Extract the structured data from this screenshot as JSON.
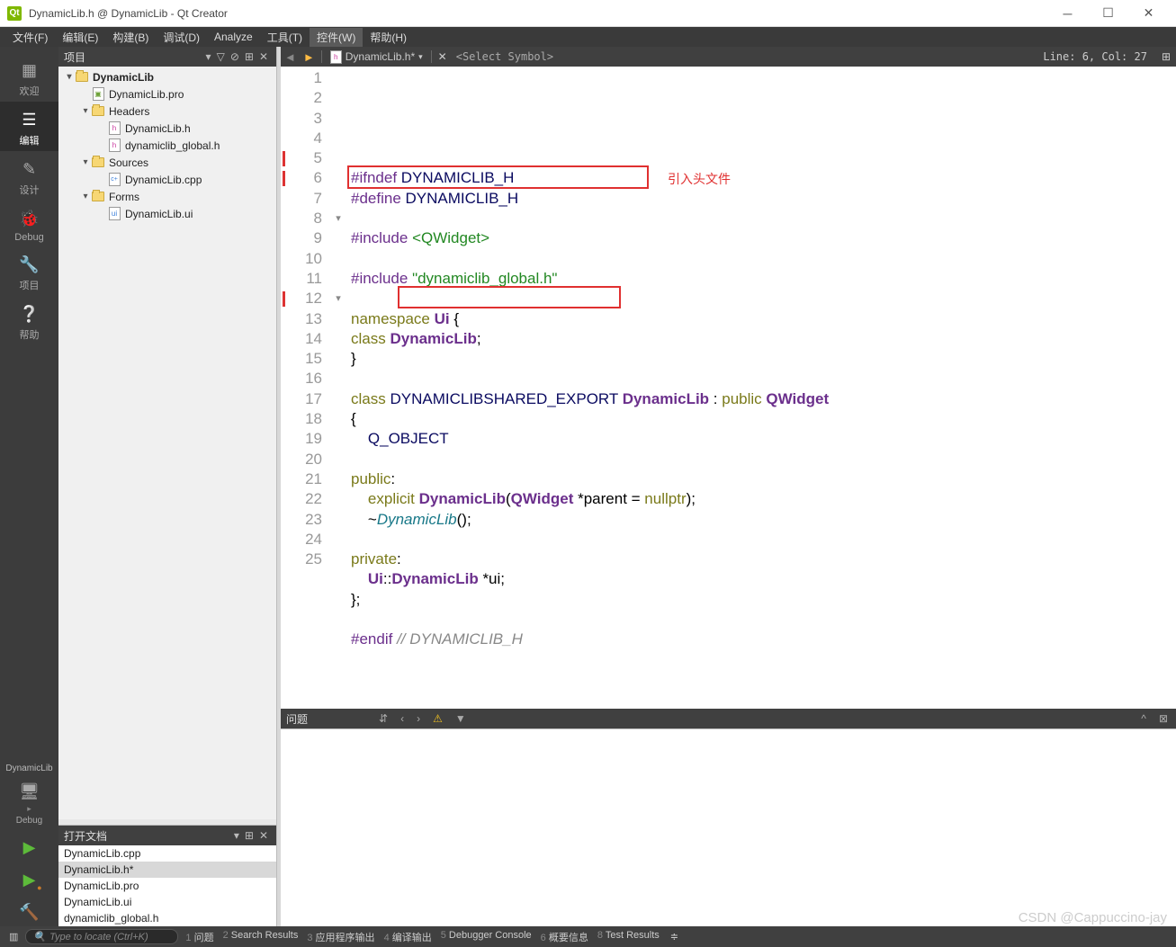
{
  "window": {
    "title": "DynamicLib.h @ DynamicLib - Qt Creator"
  },
  "menubar": {
    "items": [
      {
        "label": "文件(F)",
        "key": "F"
      },
      {
        "label": "编辑(E)",
        "key": "E"
      },
      {
        "label": "构建(B)",
        "key": "B"
      },
      {
        "label": "调试(D)",
        "key": "D"
      },
      {
        "label": "Analyze",
        "key": ""
      },
      {
        "label": "工具(T)",
        "key": "T"
      },
      {
        "label": "控件(W)",
        "key": "W",
        "active": true
      },
      {
        "label": "帮助(H)",
        "key": "H"
      }
    ]
  },
  "sidebar": {
    "items": [
      {
        "label": "欢迎",
        "icon": "grid"
      },
      {
        "label": "编辑",
        "icon": "edit",
        "active": true
      },
      {
        "label": "设计",
        "icon": "pencil"
      },
      {
        "label": "Debug",
        "icon": "bug"
      },
      {
        "label": "项目",
        "icon": "wrench"
      },
      {
        "label": "帮助",
        "icon": "help"
      }
    ],
    "kit_name": "DynamicLib",
    "debug_label": "Debug"
  },
  "project_panel": {
    "title": "项目",
    "tree": [
      {
        "level": 0,
        "arrow": "▾",
        "icon": "folder",
        "label": "DynamicLib",
        "bold": true
      },
      {
        "level": 1,
        "arrow": "",
        "icon": "pro",
        "label": "DynamicLib.pro"
      },
      {
        "level": 1,
        "arrow": "▾",
        "icon": "folder",
        "label": "Headers"
      },
      {
        "level": 2,
        "arrow": "",
        "icon": "h",
        "label": "DynamicLib.h"
      },
      {
        "level": 2,
        "arrow": "",
        "icon": "h",
        "label": "dynamiclib_global.h"
      },
      {
        "level": 1,
        "arrow": "▾",
        "icon": "folder",
        "label": "Sources"
      },
      {
        "level": 2,
        "arrow": "",
        "icon": "cpp",
        "label": "DynamicLib.cpp"
      },
      {
        "level": 1,
        "arrow": "▾",
        "icon": "folder",
        "label": "Forms"
      },
      {
        "level": 2,
        "arrow": "",
        "icon": "ui",
        "label": "DynamicLib.ui"
      }
    ]
  },
  "open_docs": {
    "title": "打开文档",
    "items": [
      {
        "label": "DynamicLib.cpp"
      },
      {
        "label": "DynamicLib.h*",
        "selected": true
      },
      {
        "label": "DynamicLib.pro"
      },
      {
        "label": "DynamicLib.ui"
      },
      {
        "label": "dynamiclib_global.h"
      }
    ]
  },
  "editor": {
    "filename": "DynamicLib.h*",
    "symbol_placeholder": "<Select Symbol>",
    "cursor": "Line: 6, Col: 27",
    "annotation": "引入头文件",
    "lines": [
      {
        "n": 1,
        "tokens": [
          [
            "c-pre",
            "#ifndef"
          ],
          [
            "",
            ""
          ],
          [
            "c-macro",
            " DYNAMICLIB_H"
          ]
        ]
      },
      {
        "n": 2,
        "tokens": [
          [
            "c-pre",
            "#define"
          ],
          [
            "c-macro",
            " DYNAMICLIB_H"
          ]
        ]
      },
      {
        "n": 3,
        "tokens": []
      },
      {
        "n": 4,
        "tokens": [
          [
            "c-pre",
            "#include"
          ],
          [
            "",
            " "
          ],
          [
            "c-inc",
            "<QWidget>"
          ]
        ]
      },
      {
        "n": 5,
        "tokens": [],
        "mark": true
      },
      {
        "n": 6,
        "tokens": [
          [
            "c-pre",
            "#include"
          ],
          [
            "",
            " "
          ],
          [
            "c-inc",
            "\"dynamiclib_global.h\""
          ]
        ],
        "mark": true
      },
      {
        "n": 7,
        "tokens": []
      },
      {
        "n": 8,
        "tokens": [
          [
            "c-kw",
            "namespace"
          ],
          [
            "",
            " "
          ],
          [
            "c-type",
            "Ui"
          ],
          [
            "",
            " {"
          ]
        ],
        "fold": "▾"
      },
      {
        "n": 9,
        "tokens": [
          [
            "c-kw",
            "class"
          ],
          [
            "",
            " "
          ],
          [
            "c-type",
            "DynamicLib"
          ],
          [
            "",
            ";"
          ]
        ]
      },
      {
        "n": 10,
        "tokens": [
          [
            "",
            "}"
          ]
        ]
      },
      {
        "n": 11,
        "tokens": []
      },
      {
        "n": 12,
        "tokens": [
          [
            "c-kw",
            "class"
          ],
          [
            "",
            " "
          ],
          [
            "c-export",
            "DYNAMICLIBSHARED_EXPORT"
          ],
          [
            "",
            " "
          ],
          [
            "c-type",
            "DynamicLib"
          ],
          [
            "",
            " : "
          ],
          [
            "c-kw",
            "public"
          ],
          [
            "",
            " "
          ],
          [
            "c-type",
            "QWidget"
          ]
        ],
        "mark": true,
        "fold": "▾"
      },
      {
        "n": 13,
        "tokens": [
          [
            "",
            "{"
          ]
        ]
      },
      {
        "n": 14,
        "tokens": [
          [
            "",
            "    "
          ],
          [
            "c-macro",
            "Q_OBJECT"
          ]
        ]
      },
      {
        "n": 15,
        "tokens": []
      },
      {
        "n": 16,
        "tokens": [
          [
            "c-kw",
            "public"
          ],
          [
            "",
            ":"
          ]
        ]
      },
      {
        "n": 17,
        "tokens": [
          [
            "",
            "    "
          ],
          [
            "c-kw",
            "explicit"
          ],
          [
            "",
            " "
          ],
          [
            "c-type",
            "DynamicLib"
          ],
          [
            "",
            "("
          ],
          [
            "c-type",
            "QWidget"
          ],
          [
            "",
            " *parent = "
          ],
          [
            "c-kw",
            "nullptr"
          ],
          [
            "",
            ");"
          ]
        ]
      },
      {
        "n": 18,
        "tokens": [
          [
            "",
            "    ~"
          ],
          [
            "c-destr",
            "DynamicLib"
          ],
          [
            "",
            "();"
          ]
        ]
      },
      {
        "n": 19,
        "tokens": []
      },
      {
        "n": 20,
        "tokens": [
          [
            "c-kw",
            "private"
          ],
          [
            "",
            ":"
          ]
        ]
      },
      {
        "n": 21,
        "tokens": [
          [
            "",
            "    "
          ],
          [
            "c-type",
            "Ui"
          ],
          [
            "",
            "::"
          ],
          [
            "c-type",
            "DynamicLib"
          ],
          [
            "",
            " *ui;"
          ]
        ]
      },
      {
        "n": 22,
        "tokens": [
          [
            "",
            "};"
          ]
        ]
      },
      {
        "n": 23,
        "tokens": []
      },
      {
        "n": 24,
        "tokens": [
          [
            "c-pre",
            "#endif"
          ],
          [
            "",
            " "
          ],
          [
            "c-com",
            "// DYNAMICLIB_H"
          ]
        ]
      },
      {
        "n": 25,
        "tokens": []
      }
    ]
  },
  "problems": {
    "title": "问题"
  },
  "statusbar": {
    "search_placeholder": "Type to locate (Ctrl+K)",
    "tabs": [
      {
        "n": "1",
        "label": "问题"
      },
      {
        "n": "2",
        "label": "Search Results"
      },
      {
        "n": "3",
        "label": "应用程序输出"
      },
      {
        "n": "4",
        "label": "编译输出"
      },
      {
        "n": "5",
        "label": "Debugger Console"
      },
      {
        "n": "6",
        "label": "概要信息"
      },
      {
        "n": "8",
        "label": "Test Results"
      }
    ]
  },
  "watermark": "CSDN @Cappuccino-jay"
}
